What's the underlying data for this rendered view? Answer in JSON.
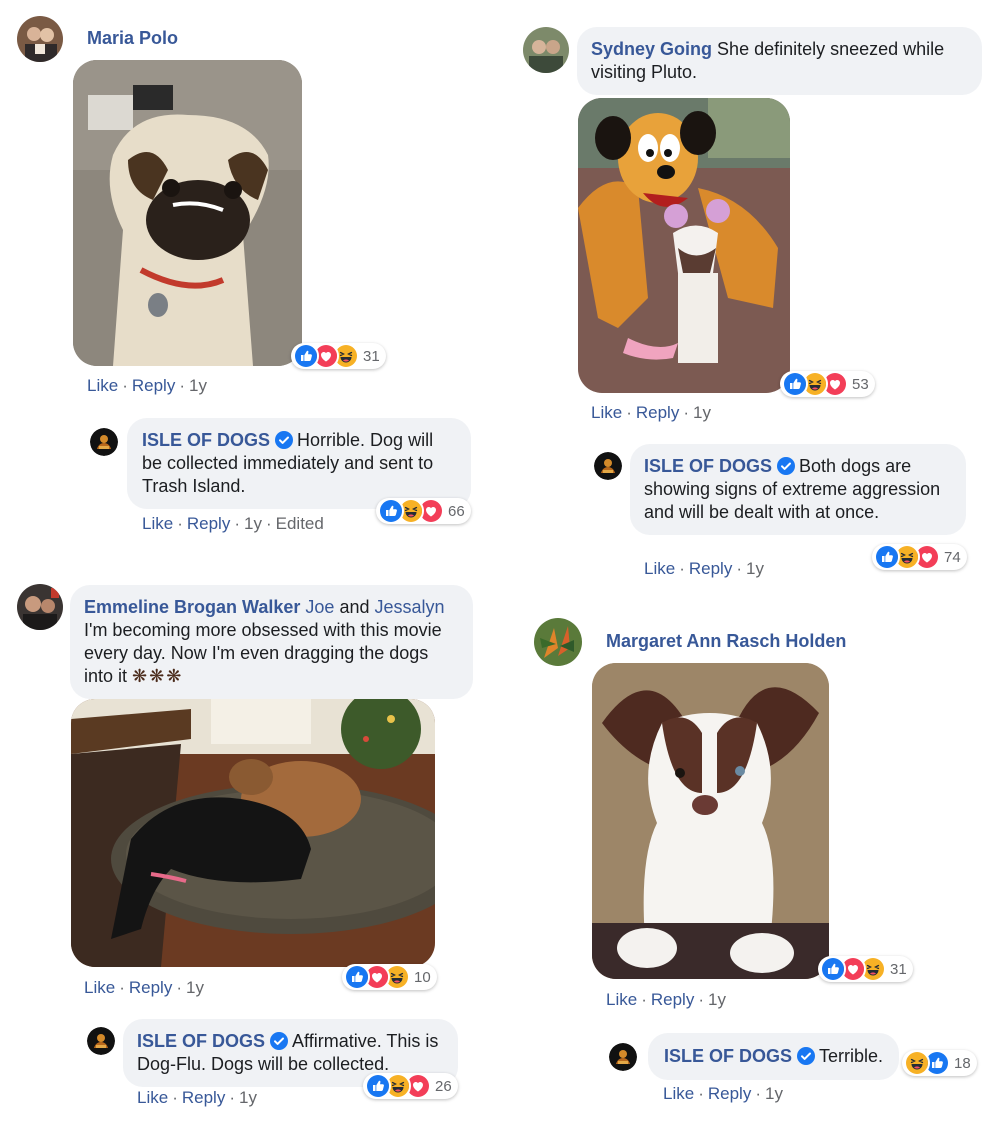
{
  "comments": [
    {
      "author": "Maria Polo",
      "reactions": {
        "count": "31",
        "icons": [
          "like",
          "love",
          "haha"
        ]
      },
      "actions": {
        "like": "Like",
        "reply": "Reply",
        "time": "1y"
      },
      "reply": {
        "author": "ISLE OF DOGS",
        "text": "Horrible. Dog will be collected immediately and sent to Trash Island.",
        "reactions": {
          "count": "66",
          "icons": [
            "like",
            "haha",
            "love"
          ]
        },
        "actions": {
          "like": "Like",
          "reply": "Reply",
          "time": "1y",
          "edited": "Edited"
        }
      }
    },
    {
      "author": "Sydney Going",
      "text": "She definitely sneezed while visiting Pluto.",
      "reactions": {
        "count": "53",
        "icons": [
          "like",
          "haha",
          "love"
        ]
      },
      "actions": {
        "like": "Like",
        "reply": "Reply",
        "time": "1y"
      },
      "reply": {
        "author": "ISLE OF DOGS",
        "text": "Both dogs are showing signs of extreme aggression and will be dealt with at once.",
        "reactions": {
          "count": "74",
          "icons": [
            "like",
            "haha",
            "love"
          ]
        },
        "actions": {
          "like": "Like",
          "reply": "Reply",
          "time": "1y"
        }
      }
    },
    {
      "author": "Emmeline Brogan Walker",
      "tag1": "Joe",
      "and": "and",
      "tag2": "Jessalyn",
      "text": "I'm becoming more obsessed with this movie every day. Now I'm even dragging the dogs into it",
      "reactions": {
        "count": "10",
        "icons": [
          "like",
          "love",
          "haha"
        ]
      },
      "actions": {
        "like": "Like",
        "reply": "Reply",
        "time": "1y"
      },
      "reply": {
        "author": "ISLE OF DOGS",
        "text": "Affirmative. This is Dog-Flu. Dogs will be collected.",
        "reactions": {
          "count": "26",
          "icons": [
            "like",
            "haha",
            "love"
          ]
        },
        "actions": {
          "like": "Like",
          "reply": "Reply",
          "time": "1y"
        }
      }
    },
    {
      "author": "Margaret Ann Rasch Holden",
      "reactions": {
        "count": "31",
        "icons": [
          "like",
          "love",
          "haha"
        ]
      },
      "actions": {
        "like": "Like",
        "reply": "Reply",
        "time": "1y"
      },
      "reply": {
        "author": "ISLE OF DOGS",
        "text": "Terrible.",
        "reactions": {
          "count": "18",
          "icons": [
            "haha",
            "like"
          ]
        },
        "actions": {
          "like": "Like",
          "reply": "Reply",
          "time": "1y"
        }
      }
    }
  ],
  "colors": {
    "name": "#385898",
    "bubble": "#f0f2f5",
    "like": "#1877f2",
    "love": "#f33e58",
    "haha": "#f7b125",
    "verified": "#1877f2"
  }
}
